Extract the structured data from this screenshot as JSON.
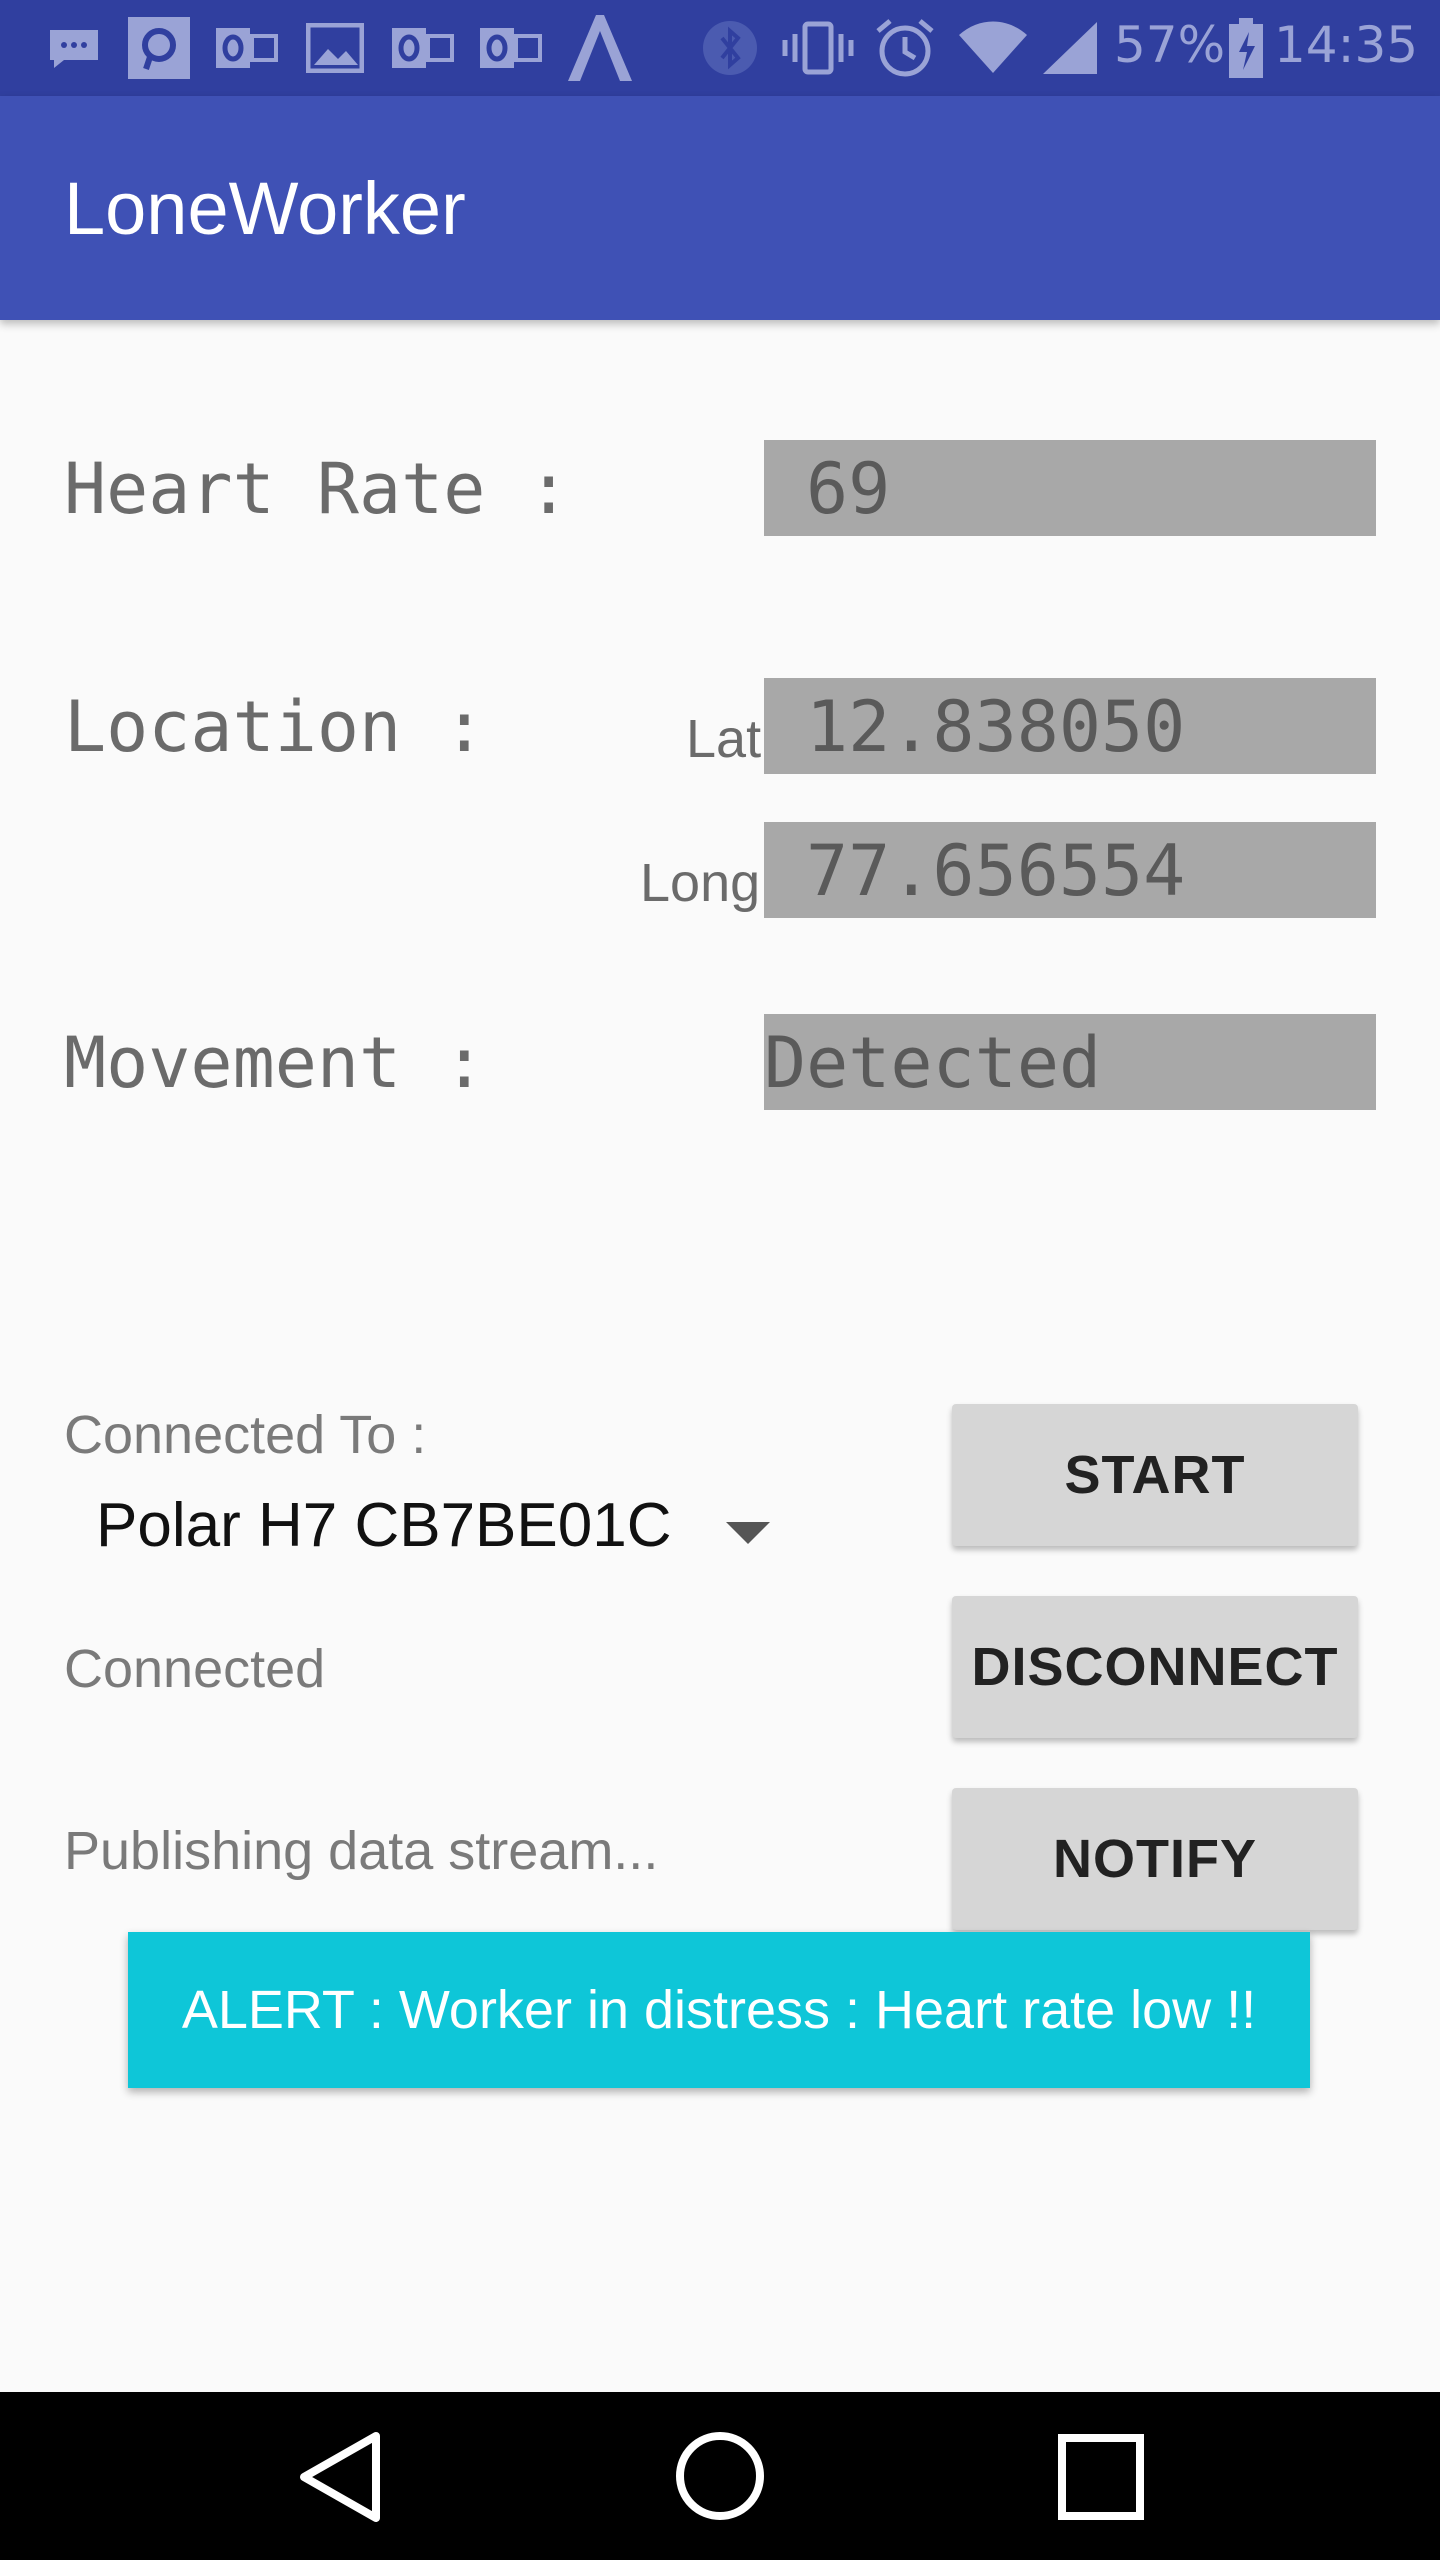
{
  "status_bar": {
    "battery_percent": "57%",
    "time": "14:35",
    "icons": [
      "chat-icon",
      "p-app-icon",
      "outlook-icon",
      "image-icon",
      "outlook-icon",
      "outlook-icon",
      "a-app-icon",
      "bluetooth-icon",
      "vibrate-icon",
      "alarm-icon",
      "wifi-icon",
      "signal-icon",
      "battery-icon"
    ]
  },
  "app_bar": {
    "title": "LoneWorker"
  },
  "readings": {
    "heart_rate_label": "Heart Rate :",
    "heart_rate_value": "69",
    "location_label": "Location :",
    "lat_label": "Lat",
    "lat_value": "12.838050",
    "long_label": "Long",
    "long_value": "77.656554",
    "movement_label": "Movement :",
    "movement_value": "Detected"
  },
  "connection": {
    "connected_to_label": "Connected To :",
    "device": "Polar H7 CB7BE01C",
    "status": "Connected",
    "stream_status": "Publishing data stream..."
  },
  "buttons": {
    "start": "START",
    "disconnect": "DISCONNECT",
    "notify": "NOTIFY"
  },
  "alert": {
    "message": "ALERT : Worker in distress : Heart rate low !!"
  },
  "nav_bar": {
    "icons": [
      "back-icon",
      "home-icon",
      "recents-icon"
    ]
  }
}
